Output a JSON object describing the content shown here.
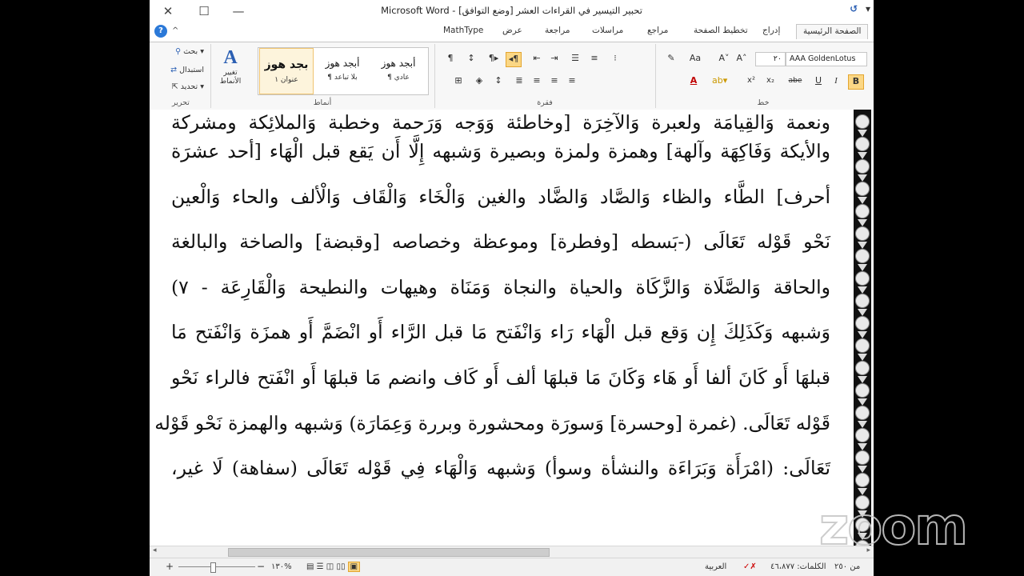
{
  "window": {
    "title": "تحبير التيسير في القراءات العشر [وضع التوافق] - Microsoft Word",
    "close": "✕",
    "maximize": "☐",
    "minimize": "—"
  },
  "qat": {
    "save": "↺",
    "redo": "▾"
  },
  "tabs": {
    "home": "الصفحة الرئيسية",
    "insert": "إدراج",
    "layout": "تخطيط الصفحة",
    "references": "مراجع",
    "mailings": "مراسلات",
    "review": "مراجعة",
    "view": "عرض",
    "mathtype": "MathType",
    "help": "?",
    "collapse": "^"
  },
  "ribbon": {
    "font": {
      "label": "خط",
      "font_name": "AAA GoldenLotus",
      "font_size": "٢٠",
      "bold": "B",
      "italic": "I",
      "underline": "U",
      "strike": "abe",
      "subscript": "x₂",
      "superscript": "x²",
      "grow": "A˄",
      "shrink": "A˅",
      "change_case": "Aa",
      "clear": "✎"
    },
    "paragraph": {
      "label": "فقرة"
    },
    "styles": {
      "label": "أنماط",
      "items": [
        {
          "preview": "أبجد هوز",
          "name": "¶ عادي"
        },
        {
          "preview": "أبجد هوز",
          "name": "¶ بلا تباعد"
        },
        {
          "preview": "بجد هوز",
          "name": "عنوان ١"
        }
      ],
      "change": "تغيير الأنماط"
    },
    "editing": {
      "label": "تحرير",
      "find": "بحث",
      "replace": "استبدال",
      "select": "تحديد"
    }
  },
  "document": {
    "lines": [
      "ونعمة وَالقِيامَة ولعبرة وَالآخِرَة [وخاطئة وَوَجه وَرَحمة وخطبة وَالملائِكة ومشركة",
      "والأيكة وَفَاكِهَة وآلهة] وهمزة ولمزة وبصيرة وَشبهه إِلَّا أَن يَقع قبل الْهَاء [أحد عشرَة",
      "أحرف] الطَّاء والظاء وَالصَّاد وَالضَّاد والغين وَالْخَاء وَالْقَاف وَالْألف والحاء وَالْعين",
      "نَحْو قَوْله تَعَالَى (-بَسطه [وفطرة] وموعظة وخصاصه [وقبضة] والصاخة والبالغة",
      "والحاقة وَالصَّلَاة وَالزَّكَاة والحياة والنجاة وَمَنَاة وهيهات والنطيحة وَالْقَارِعَة - ٧)",
      "وَشبهه وَكَذَلِكَ إِن وَقع قبل الْهَاء رَاء وَانْفَتح مَا قبل الرَّاء أَو انْضَمَّ أَو همزَة وَانْفَتح مَا",
      "قبلهَا أَو كَانَ ألفا أَو هَاء وَكَانَ مَا قبلهَا ألف أَو كَاف وانضم مَا قبلهَا أَو انْفَتح فالراء نَحْو",
      "قَوْله تَعَالَى. (غمرة [وحسرة] وَسورَة ومحشورة وبررة وَعِمَارَة) وَشبهه والهمزة نَحْو قَوْله",
      "تَعَالَى: (امْرَأَة وَبَرَاءَة والنشأة وسوأ) وَشبهه وَالْهَاء فِي قَوْله تَعَالَى (سفاهة) لَا غير،"
    ]
  },
  "status": {
    "page": "من ٢٥٠",
    "words": "الكلمات: ٤٦،٨٧٧",
    "language": "العربية",
    "zoom": "%١٣٠",
    "minus": "−",
    "plus": "+"
  },
  "watermark": "zoom"
}
